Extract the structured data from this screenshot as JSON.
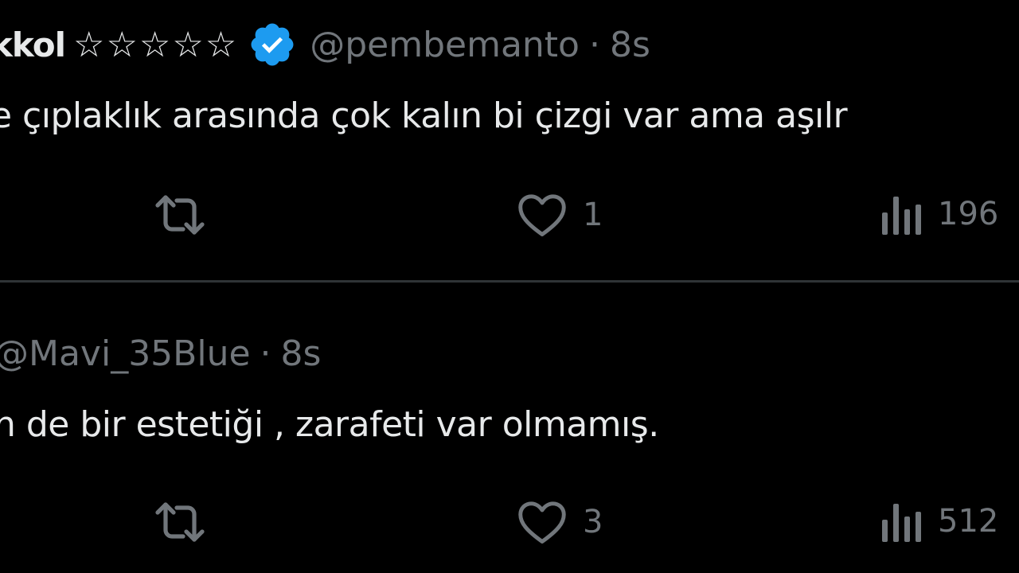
{
  "colors": {
    "background": "#000000",
    "text_primary": "#e7e9ea",
    "text_secondary": "#71767b",
    "verified_badge": "#1d9bf0",
    "divider": "#2f3336"
  },
  "tweets": [
    {
      "display_name": "kkol",
      "stars": "☆☆☆☆☆",
      "verified": true,
      "verified_icon": "verified-badge-icon",
      "handle": "@pembemanto",
      "separator": "·",
      "time": "8s",
      "text": "e çıplaklık arasında çok kalın bi çizgi var ama aşılr",
      "actions": {
        "retweet_icon": "retweet-icon",
        "retweet_count": "",
        "like_icon": "heart-icon",
        "like_count": "1",
        "views_icon": "views-chart-icon",
        "views_count": "196"
      }
    },
    {
      "handle": "@Mavi_35Blue",
      "separator": "·",
      "time": "8s",
      "text": "n de bir estetiği , zarafeti var olmamış.",
      "actions": {
        "retweet_icon": "retweet-icon",
        "retweet_count": "",
        "like_icon": "heart-icon",
        "like_count": "3",
        "views_icon": "views-chart-icon",
        "views_count": "512"
      }
    }
  ]
}
